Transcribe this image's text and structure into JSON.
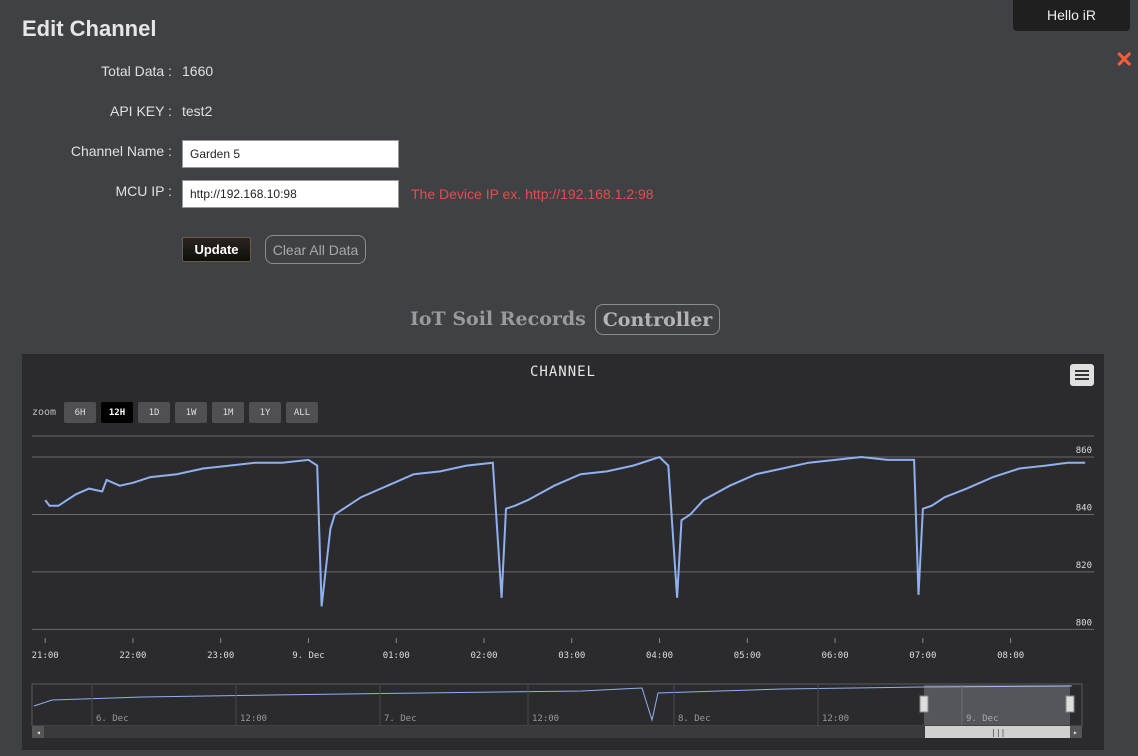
{
  "header": {
    "title": "Edit Channel",
    "user_greeting": "Hello iR",
    "close_symbol": "✕"
  },
  "form": {
    "total_data_label": "Total Data :",
    "total_data_value": "1660",
    "api_key_label": "API KEY :",
    "api_key_value": "test2",
    "channel_name_label": "Channel Name :",
    "channel_name_value": "Garden 5",
    "mcu_ip_label": "MCU IP :",
    "mcu_ip_value": "http://192.168.10:98",
    "mcu_ip_hint": "The Device IP ex. http://192.168.1.2:98",
    "update_label": "Update",
    "clear_label": "Clear All Data"
  },
  "section": {
    "title": "IoT Soil Records",
    "controller_label": "Controller"
  },
  "colors": {
    "background": "#3f4145",
    "chart_bg": "#2b2b2e",
    "series": "#90b0f0",
    "hint": "#e34d4d",
    "close": "#ff5a3c"
  },
  "chart": {
    "zoom_label": "zoom",
    "zoom_buttons": [
      "6H",
      "12H",
      "1D",
      "1W",
      "1M",
      "1Y",
      "ALL"
    ],
    "active_zoom": "12H",
    "menu_icon": "hamburger-icon"
  },
  "chart_data": {
    "type": "line",
    "title": "CHANNEL",
    "xlabel": "",
    "ylabel": "",
    "ylim": [
      800,
      860
    ],
    "y_ticks": [
      "800",
      "820",
      "840",
      "860"
    ],
    "x_ticks": [
      "21:00",
      "22:00",
      "23:00",
      "9. Dec",
      "01:00",
      "02:00",
      "03:00",
      "04:00",
      "05:00",
      "06:00",
      "07:00",
      "08:00"
    ],
    "x_start_label": "21:00",
    "x_end_label": "08:00",
    "grid": true,
    "series": [
      {
        "x": [
          0,
          0.05,
          0.15,
          0.35,
          0.5,
          0.65,
          0.7,
          0.85,
          1.0,
          1.2,
          1.5,
          1.8,
          2.1,
          2.4,
          2.7,
          3.0,
          3.1,
          3.15,
          3.25,
          3.3,
          3.45,
          3.6,
          3.9,
          4.2,
          4.5,
          4.8,
          5.1,
          5.2,
          5.25,
          5.35,
          5.5,
          5.8,
          6.1,
          6.4,
          6.7,
          7.0,
          7.1,
          7.2,
          7.25,
          7.35,
          7.5,
          7.8,
          8.1,
          8.4,
          8.7,
          9.0,
          9.3,
          9.6,
          9.9,
          9.95,
          10.0,
          10.1,
          10.25,
          10.5,
          10.8,
          11.1,
          11.4,
          11.65,
          11.85
        ],
        "y": [
          845,
          843,
          843,
          847,
          849,
          848,
          852,
          850,
          851,
          853,
          854,
          856,
          857,
          858,
          858,
          859,
          857,
          808,
          835,
          840,
          843,
          846,
          850,
          854,
          855,
          857,
          858,
          811,
          842,
          843,
          845,
          850,
          854,
          855,
          857,
          860,
          857,
          811,
          838,
          840,
          845,
          850,
          854,
          856,
          858,
          859,
          860,
          859,
          859,
          812,
          842,
          843,
          846,
          849,
          853,
          856,
          857,
          858,
          858
        ]
      }
    ],
    "navigator": {
      "labels": [
        "6. Dec",
        "12:00",
        "7. Dec",
        "12:00",
        "8. Dec",
        "12:00",
        "9. Dec"
      ]
    }
  }
}
